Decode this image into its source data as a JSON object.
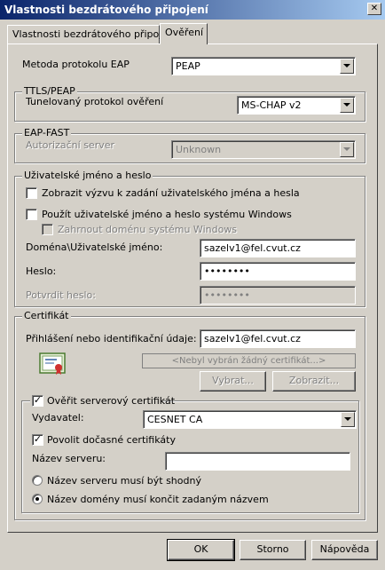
{
  "window": {
    "title": "Vlastnosti bezdrátového připojení",
    "close_symbol": "✕"
  },
  "tabs": [
    {
      "label": "Vlastnosti bezdrátového připojení"
    },
    {
      "label": "Ověření"
    }
  ],
  "eap": {
    "method_label": "Metoda protokolu EAP",
    "method_value": "PEAP"
  },
  "ttls": {
    "group_label": "TTLS/PEAP",
    "tunnel_label": "Tunelovaný protokol ověření",
    "tunnel_value": "MS-CHAP v2"
  },
  "eapfast": {
    "group_label": "EAP-FAST",
    "auth_server_label": "Autorizační server",
    "auth_server_value": "Unknown"
  },
  "credentials": {
    "group_label": "Uživatelské jméno a heslo",
    "prompt_label": "Zobrazit výzvu k zadání uživatelského jména a hesla",
    "prompt_checked": "",
    "use_windows_label": "Použít uživatelské jméno a heslo systému Windows",
    "use_windows_checked": "",
    "include_domain_label": "Zahrnout doménu systému Windows",
    "include_domain_checked": "",
    "username_label": "Doména\\Uživatelské jméno:",
    "username_value": "sazelv1@fel.cvut.cz",
    "password_label": "Heslo:",
    "password_value": "••••••••",
    "confirm_label": "Potvrdit heslo:",
    "confirm_value": "••••••••"
  },
  "certificate": {
    "group_label": "Certifikát",
    "login_label": "Přihlášení nebo identifikační údaje:",
    "login_value": "sazelv1@fel.cvut.cz",
    "no_cert_text": "<Nebyl vybrán žádný certifikát...>",
    "select_button": "Vybrat...",
    "view_button": "Zobrazit...",
    "icon": "certificate-icon"
  },
  "server_cert": {
    "verify_label": "Ověřit serverový certifikát",
    "verify_checked": "✓",
    "issuer_label": "Vydavatel:",
    "issuer_value": "CESNET CA",
    "allow_temp_label": "Povolit dočasné certifikáty",
    "allow_temp_checked": "✓",
    "server_name_label": "Název serveru:",
    "server_name_value": "",
    "exact_match_label": "Název serveru musí být shodný",
    "domain_suffix_label": "Název domény musí končit zadaným názvem",
    "selected_option": "domain_suffix"
  },
  "buttons": {
    "ok": "OK",
    "cancel": "Storno",
    "help": "Nápověda"
  }
}
